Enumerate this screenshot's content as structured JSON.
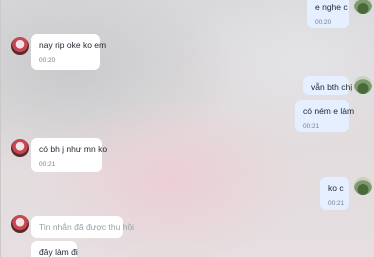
{
  "messages": [
    {
      "id": "m1",
      "side": "out",
      "text": "e nghe c",
      "time": "00:20"
    },
    {
      "id": "m2",
      "side": "in",
      "text": "nay rip oke ko em",
      "time": "00:20"
    },
    {
      "id": "m3",
      "side": "out",
      "text": "vẫn bth chị",
      "time": ""
    },
    {
      "id": "m4",
      "side": "out",
      "text": "có ném e làm",
      "time": "00:21"
    },
    {
      "id": "m5",
      "side": "in",
      "text": "có bh j như mn ko",
      "time": "00:21"
    },
    {
      "id": "m6",
      "side": "out",
      "text": "ko c",
      "time": "00:21"
    },
    {
      "id": "m7",
      "side": "in",
      "text": "Tin nhắn đã được thu hồi",
      "time": "",
      "recalled": true
    },
    {
      "id": "m8",
      "side": "in",
      "text": "đây làm đi",
      "time": ""
    }
  ]
}
